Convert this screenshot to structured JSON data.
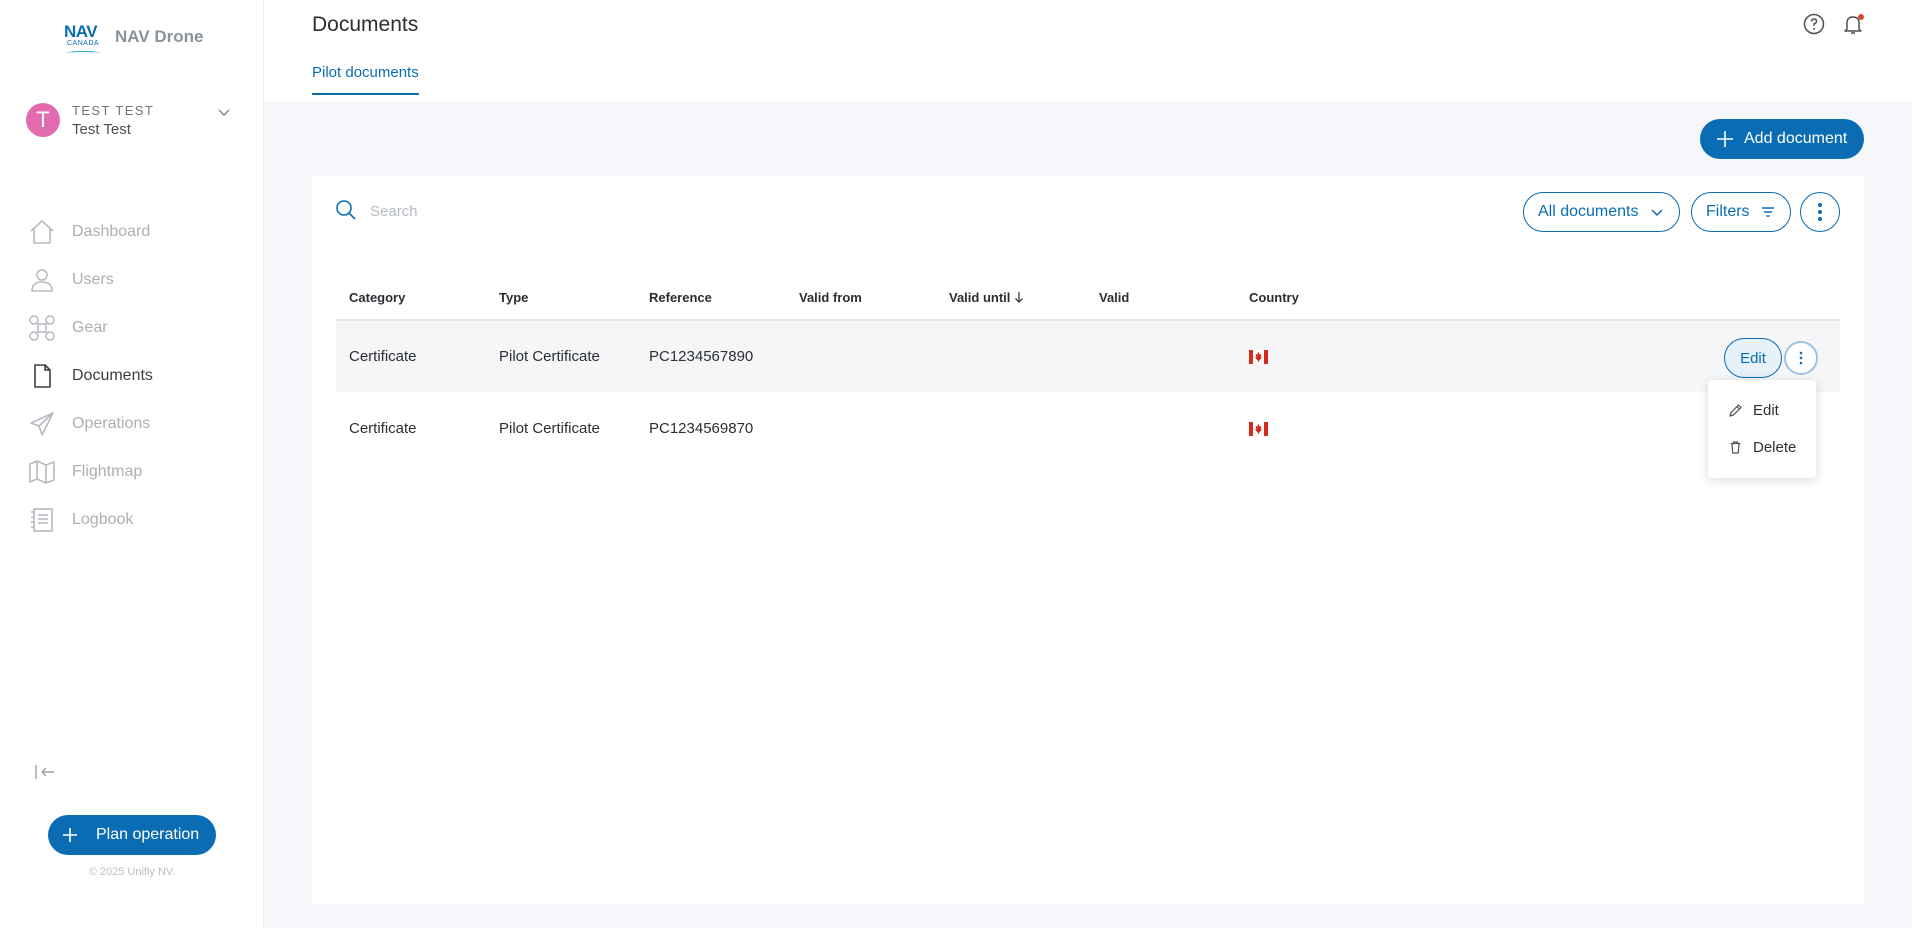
{
  "app": {
    "logo_mark": "NAV",
    "logo_sub": "CANADA",
    "name": "NAV Drone"
  },
  "user": {
    "upper": "TEST TEST",
    "name": "Test Test",
    "initial": "T",
    "avatar_color": "#e26bb0"
  },
  "nav": {
    "items": [
      {
        "label": "Dashboard",
        "icon": "home-icon"
      },
      {
        "label": "Users",
        "icon": "user-icon"
      },
      {
        "label": "Gear",
        "icon": "drone-icon"
      },
      {
        "label": "Documents",
        "icon": "document-icon",
        "active": true
      },
      {
        "label": "Operations",
        "icon": "paper-plane-icon"
      },
      {
        "label": "Flightmap",
        "icon": "map-icon"
      },
      {
        "label": "Logbook",
        "icon": "logbook-icon"
      }
    ]
  },
  "sidebar": {
    "plan_label": "Plan operation",
    "copyright": "© 2025 Unifly NV."
  },
  "header": {
    "title": "Documents",
    "tab": "Pilot documents"
  },
  "toolbar": {
    "add_label": "Add document",
    "search_placeholder": "Search",
    "filter_scope": "All documents",
    "filters_label": "Filters"
  },
  "table": {
    "columns": [
      "Category",
      "Type",
      "Reference",
      "Valid from",
      "Valid until",
      "Valid",
      "Country"
    ],
    "sort_column": "Valid until",
    "rows": [
      {
        "category": "Certificate",
        "type": "Pilot Certificate",
        "reference": "PC1234567890",
        "valid_from": "",
        "valid_until": "",
        "valid": "",
        "country": "CA"
      },
      {
        "category": "Certificate",
        "type": "Pilot Certificate",
        "reference": "PC1234569870",
        "valid_from": "",
        "valid_until": "",
        "valid": "",
        "country": "CA"
      }
    ]
  },
  "row_actions": {
    "edit_label": "Edit"
  },
  "dropdown": {
    "items": [
      {
        "label": "Edit",
        "icon": "pencil-icon"
      },
      {
        "label": "Delete",
        "icon": "trash-icon"
      }
    ]
  },
  "colors": {
    "primary": "#0a6db3",
    "flag_red": "#d52b1e"
  }
}
